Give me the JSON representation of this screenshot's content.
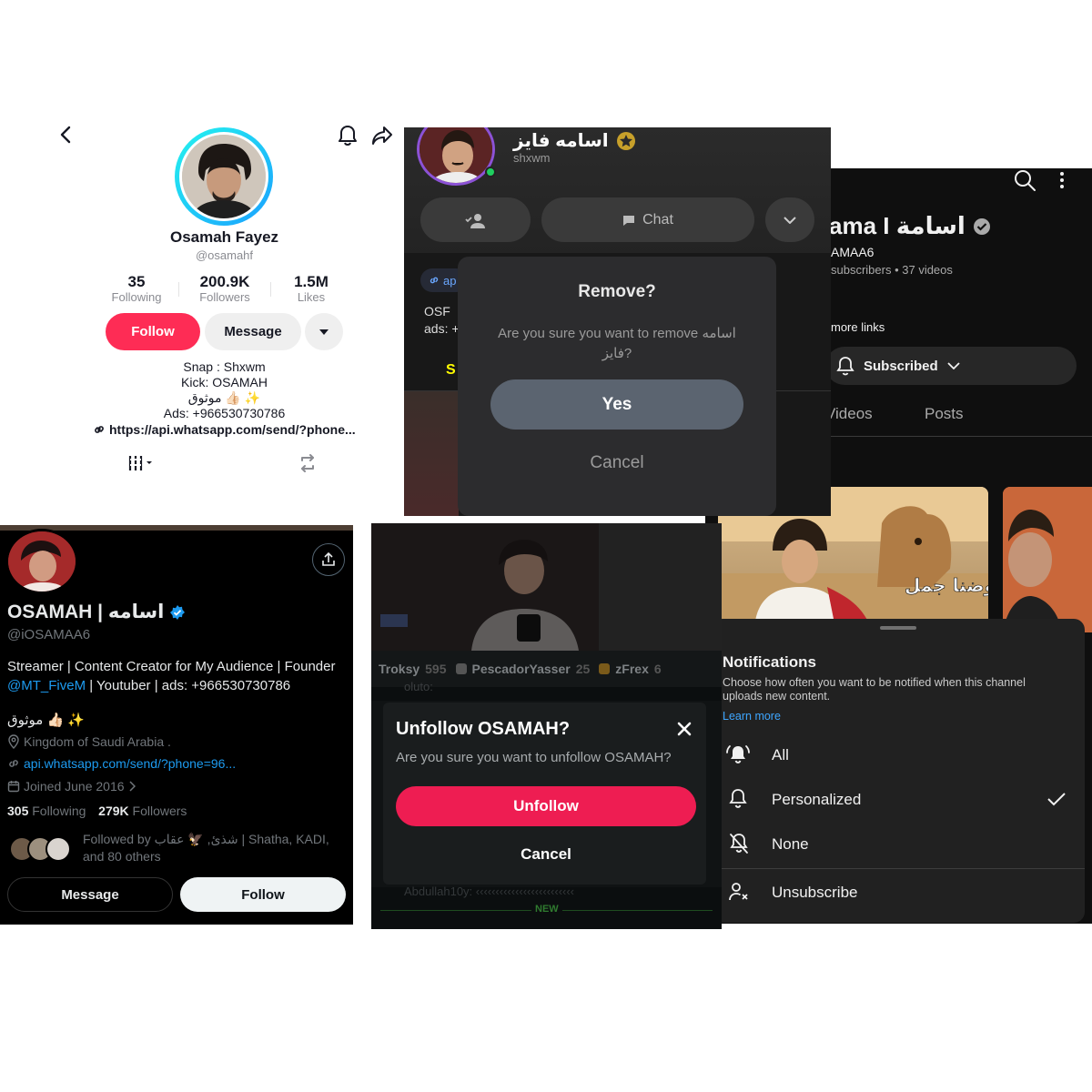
{
  "tiktok": {
    "name": "Osamah Fayez",
    "handle": "@osamahf",
    "stats": [
      {
        "value": "35",
        "label": "Following"
      },
      {
        "value": "200.9K",
        "label": "Followers"
      },
      {
        "value": "1.5M",
        "label": "Likes"
      }
    ],
    "follow_label": "Follow",
    "message_label": "Message",
    "bio": [
      "Snap : Shxwm",
      "Kick: OSAMAH",
      "موثوق 👍🏻 ✨",
      "Ads: +966530730786"
    ],
    "link": "https://api.whatsapp.com/send/?phone...",
    "accent": "#fe2c55"
  },
  "snapchat": {
    "name": "اسامه فايز",
    "username": "shxwm",
    "chat_label": "Chat",
    "link_partial": "ap",
    "bio_partial": [
      "OSF",
      "ads: +"
    ],
    "tab_partial": "S",
    "dialog": {
      "title": "Remove?",
      "body": "Are you sure you want to remove اسامه فايز?",
      "yes": "Yes",
      "cancel": "Cancel"
    }
  },
  "youtube": {
    "channel_name": "ama I اسامة",
    "handle": "AMAA6",
    "meta": "subscribers • 37 videos",
    "more_links": "more links",
    "subscribed_label": "Subscribed",
    "tabs": [
      "Videos",
      "Posts"
    ],
    "tab_partial": "ts",
    "thumb_text": "روضنا جمل",
    "sheet": {
      "title": "Notifications",
      "desc": "Choose how often you want to be notified when this channel uploads new content.",
      "learn_more": "Learn more",
      "options": [
        {
          "label": "All",
          "icon": "bell-ringing-icon"
        },
        {
          "label": "Personalized",
          "icon": "bell-icon",
          "selected": true
        },
        {
          "label": "None",
          "icon": "bell-off-icon"
        }
      ],
      "unsubscribe": "Unsubscribe"
    }
  },
  "x": {
    "name": "OSAMAH | اسامه",
    "handle": "@iOSAMAA6",
    "bio_line1": "Streamer | Content Creator for My Audience | Founder",
    "bio_mention": "@MT_FiveM",
    "bio_line2_rest": " | Youtuber | ads: +966530730786",
    "verified_text": "موثوق 👍🏻 ✨",
    "location": "Kingdom of Saudi Arabia .",
    "link": "api.whatsapp.com/send/?phone=96...",
    "joined": "Joined June 2016",
    "following_count": "305",
    "following_label": "Following",
    "followers_count": "279K",
    "followers_label": "Followers",
    "followed_by": "Followed by شذئ, 🦅 عقاب | Shatha, KADI, and 80 others",
    "message_label": "Message",
    "follow_label": "Follow",
    "accent": "#1d9bf0"
  },
  "kick": {
    "leaderboard": [
      {
        "name": "Troksy",
        "count": "595"
      },
      {
        "name": "PescadorYasser",
        "count": "25"
      },
      {
        "name": "zFrex",
        "count": "6"
      }
    ],
    "chat_partial_1": "oluto:",
    "chat_partial_2": "Abdullah10y: ‹‹‹‹‹‹‹‹‹‹‹‹‹‹‹‹‹‹‹‹‹‹‹‹‹",
    "new_label": "NEW",
    "dialog": {
      "title": "Unfollow OSAMAH?",
      "body": "Are you sure you want to unfollow OSAMAH?",
      "unfollow": "Unfollow",
      "cancel": "Cancel"
    },
    "accent": "#ee1d52"
  }
}
